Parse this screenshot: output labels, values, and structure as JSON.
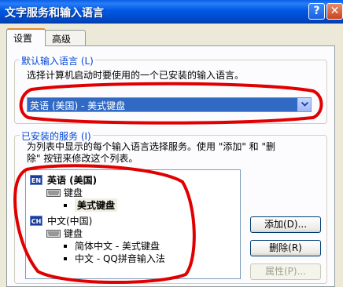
{
  "window": {
    "title": "文字服务和输入语言",
    "help_button": "?",
    "close_button": "✕"
  },
  "tabs": [
    {
      "label": "设置",
      "active": true
    },
    {
      "label": "高级",
      "active": false
    }
  ],
  "default_language": {
    "group_label": "默认输入语言 (L)",
    "description": "选择计算机启动时要使用的一个已安装的输入语言。",
    "selected_value": "英语 (美国) - 美式键盘"
  },
  "installed_services": {
    "group_label": "已安装的服务 (I)",
    "description_line1": "为列表中显示的每个输入语言选择服务。使用 \"添加\" 和 \"删",
    "description_line2": "除\" 按钮来修改这个列表。",
    "tree": {
      "lang1": {
        "badge": "EN",
        "name": "英语 (美国)",
        "category": "键盘",
        "items": [
          "美式键盘"
        ]
      },
      "lang2": {
        "badge": "CH",
        "name": "中文(中国)",
        "category": "键盘",
        "items": [
          "简体中文 - 美式键盘",
          "中文 - QQ拼音输入法"
        ]
      }
    }
  },
  "buttons": {
    "add": "添加(D)...",
    "remove": "删除(R)",
    "properties": "属性(P)..."
  },
  "colors": {
    "annotation_red": "#e00000",
    "selection_blue": "#316ac5",
    "group_label_blue": "#0046d5"
  }
}
